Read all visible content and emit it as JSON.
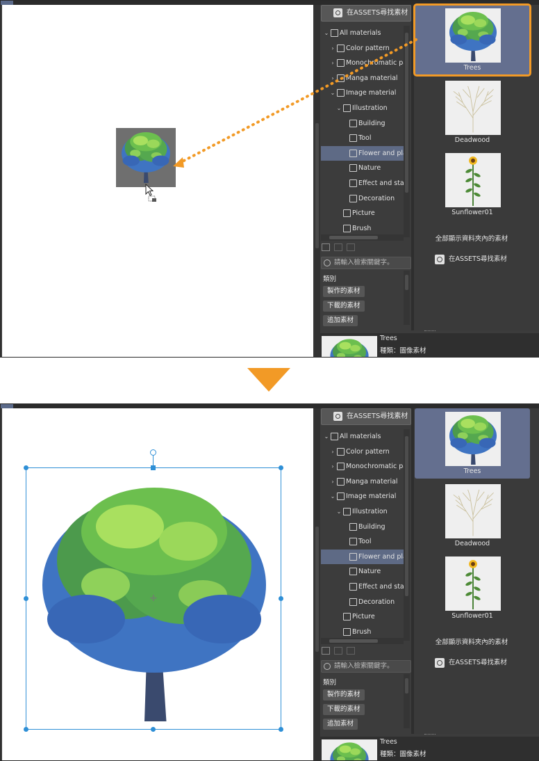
{
  "assets_button_label": "在ASSETS尋找素材",
  "tree_items": [
    {
      "label": "All materials",
      "caret": "⌄",
      "icon": "grid-icon",
      "depth": 0
    },
    {
      "label": "Color pattern",
      "caret": "›",
      "icon": "cross-icon",
      "depth": 1
    },
    {
      "label": "Monochromatic pat",
      "caret": "›",
      "icon": "cross-icon",
      "depth": 1
    },
    {
      "label": "Manga material",
      "caret": "›",
      "icon": "manga-icon",
      "depth": 1
    },
    {
      "label": "Image material",
      "caret": "⌄",
      "icon": "image-icon",
      "depth": 1
    },
    {
      "label": "Illustration",
      "caret": "⌄",
      "icon": "pencil-icon",
      "depth": 2
    },
    {
      "label": "Building",
      "caret": "",
      "icon": "pencil-icon",
      "depth": 3
    },
    {
      "label": "Tool",
      "caret": "",
      "icon": "pencil-icon",
      "depth": 3
    },
    {
      "label": "Flower and plar",
      "caret": "",
      "icon": "pencil-icon",
      "depth": 3,
      "selected": true
    },
    {
      "label": "Nature",
      "caret": "",
      "icon": "pencil-icon",
      "depth": 3
    },
    {
      "label": "Effect and stag",
      "caret": "",
      "icon": "pencil-icon",
      "depth": 3
    },
    {
      "label": "Decoration",
      "caret": "",
      "icon": "pencil-icon",
      "depth": 3
    },
    {
      "label": "Picture",
      "caret": "",
      "icon": "camera-icon",
      "depth": 2
    },
    {
      "label": "Brush",
      "caret": "",
      "icon": "brush-icon",
      "depth": 2
    }
  ],
  "search_placeholder": "請輸入檢索關鍵字。",
  "tags_title": "類別",
  "tags": [
    "製作的素材",
    "下載的素材",
    "追加素材"
  ],
  "gallery": {
    "items": [
      {
        "name": "Trees",
        "thumb": "tree-image"
      },
      {
        "name": "Deadwood",
        "thumb": "deadwood-image"
      },
      {
        "name": "Sunflower01",
        "thumb": "sunflower-image"
      }
    ],
    "show_all_label": "全部顯示資料夾內的素材",
    "assets_link_label": "在ASSETS尋找素材"
  },
  "preview": {
    "name": "Trees",
    "type_label": "種類：圖像素材"
  },
  "colors": {
    "accent_orange": "#f29a26",
    "selection_blue": "#2e8fd6",
    "panel_bg": "#3c3c3c",
    "selected_item": "#5e6a85"
  }
}
